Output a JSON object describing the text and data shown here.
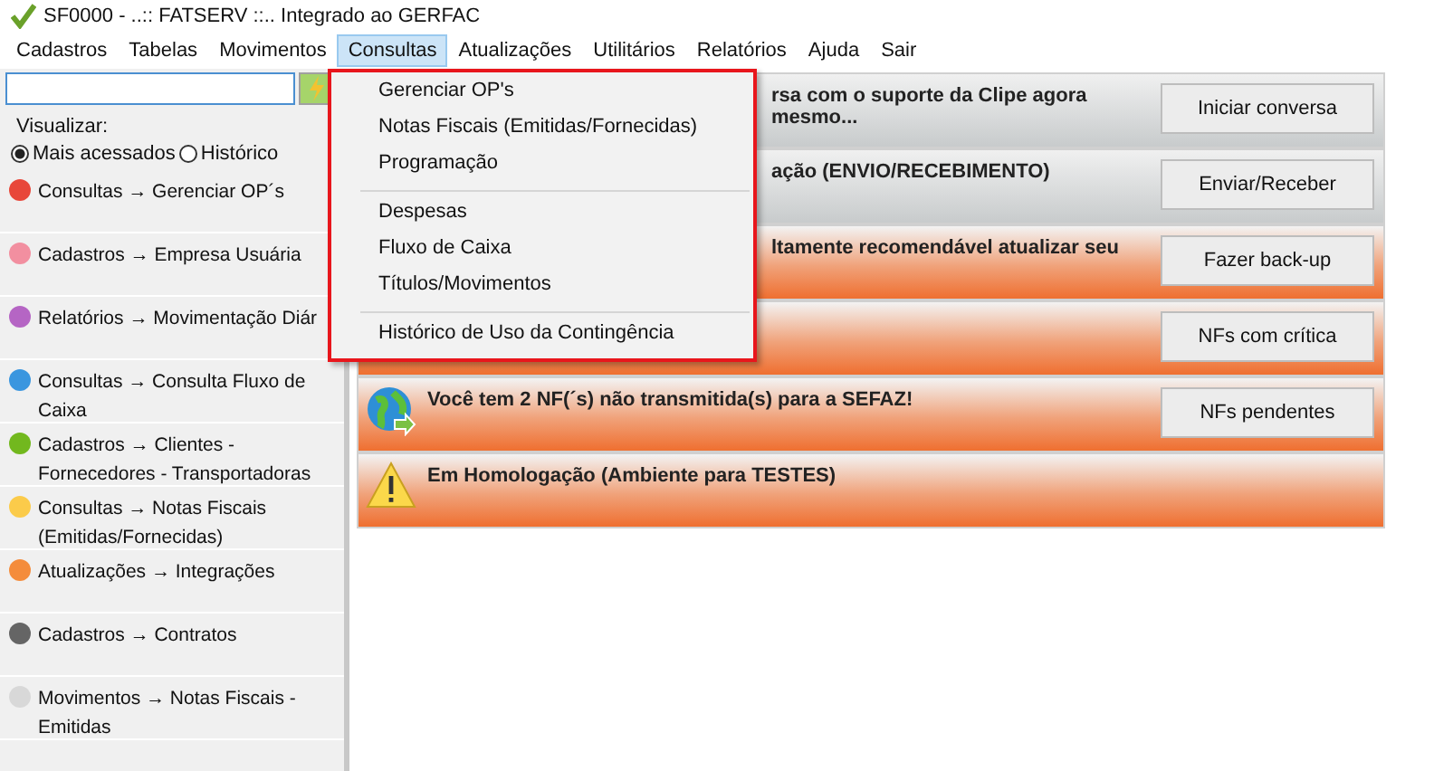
{
  "window": {
    "title": "SF0000 - ..:: FATSERV ::.. Integrado ao GERFAC"
  },
  "menu_bar": [
    {
      "label": "Cadastros",
      "selected": false
    },
    {
      "label": "Tabelas",
      "selected": false
    },
    {
      "label": "Movimentos",
      "selected": false
    },
    {
      "label": "Consultas",
      "selected": true
    },
    {
      "label": "Atualizações",
      "selected": false
    },
    {
      "label": "Utilitários",
      "selected": false
    },
    {
      "label": "Relatórios",
      "selected": false
    },
    {
      "label": "Ajuda",
      "selected": false
    },
    {
      "label": "Sair",
      "selected": false
    }
  ],
  "dropdown": {
    "groups": [
      [
        "Gerenciar OP's",
        "Notas Fiscais (Emitidas/Fornecidas)",
        "Programação"
      ],
      [
        "Despesas",
        "Fluxo de Caixa",
        "Títulos/Movimentos"
      ],
      [
        "Histórico de Uso da Contingência"
      ]
    ]
  },
  "sidebar": {
    "view_label": "Visualizar:",
    "view_options": [
      {
        "label": "Mais acessados",
        "selected": true
      },
      {
        "label": "Histórico",
        "selected": false
      }
    ],
    "items": [
      {
        "label": "Consultas → Gerenciar OP´s",
        "color": "#e8473a"
      },
      {
        "label": "Cadastros → Empresa Usuária",
        "color": "#f28fa0"
      },
      {
        "label": "Relatórios → Movimentação Diár",
        "color": "#b565c4"
      },
      {
        "label": "Consultas → Consulta Fluxo de Caixa",
        "color": "#3a96df"
      },
      {
        "label": "Cadastros → Clientes - Fornecedores - Transportadoras",
        "color": "#72b81e"
      },
      {
        "label": "Consultas → Notas Fiscais (Emitidas/Fornecidas)",
        "color": "#fbcb4a"
      },
      {
        "label": "Atualizações → Integrações",
        "color": "#f48c3c"
      },
      {
        "label": "Cadastros → Contratos",
        "color": "#656565"
      },
      {
        "label": "Movimentos → Notas Fiscais - Emitidas",
        "color": "#d8d8d8"
      }
    ]
  },
  "notifications": [
    {
      "kind": "info",
      "message": "rsa com o suporte da Clipe agora mesmo...",
      "button": "Iniciar conversa"
    },
    {
      "kind": "info",
      "message": "ação (ENVIO/RECEBIMENTO)",
      "button": "Enviar/Receber"
    },
    {
      "kind": "alert",
      "message": "ltamente recomendável atualizar seu",
      "button": "Fazer back-up"
    },
    {
      "kind": "alert",
      "button": "NFs com crítica"
    },
    {
      "kind": "globe",
      "message": "Você tem 2 NF(´s) não transmitida(s) para a SEFAZ!",
      "button": "NFs pendentes"
    },
    {
      "kind": "warning",
      "message": "Em Homologação (Ambiente para TESTES)"
    }
  ]
}
